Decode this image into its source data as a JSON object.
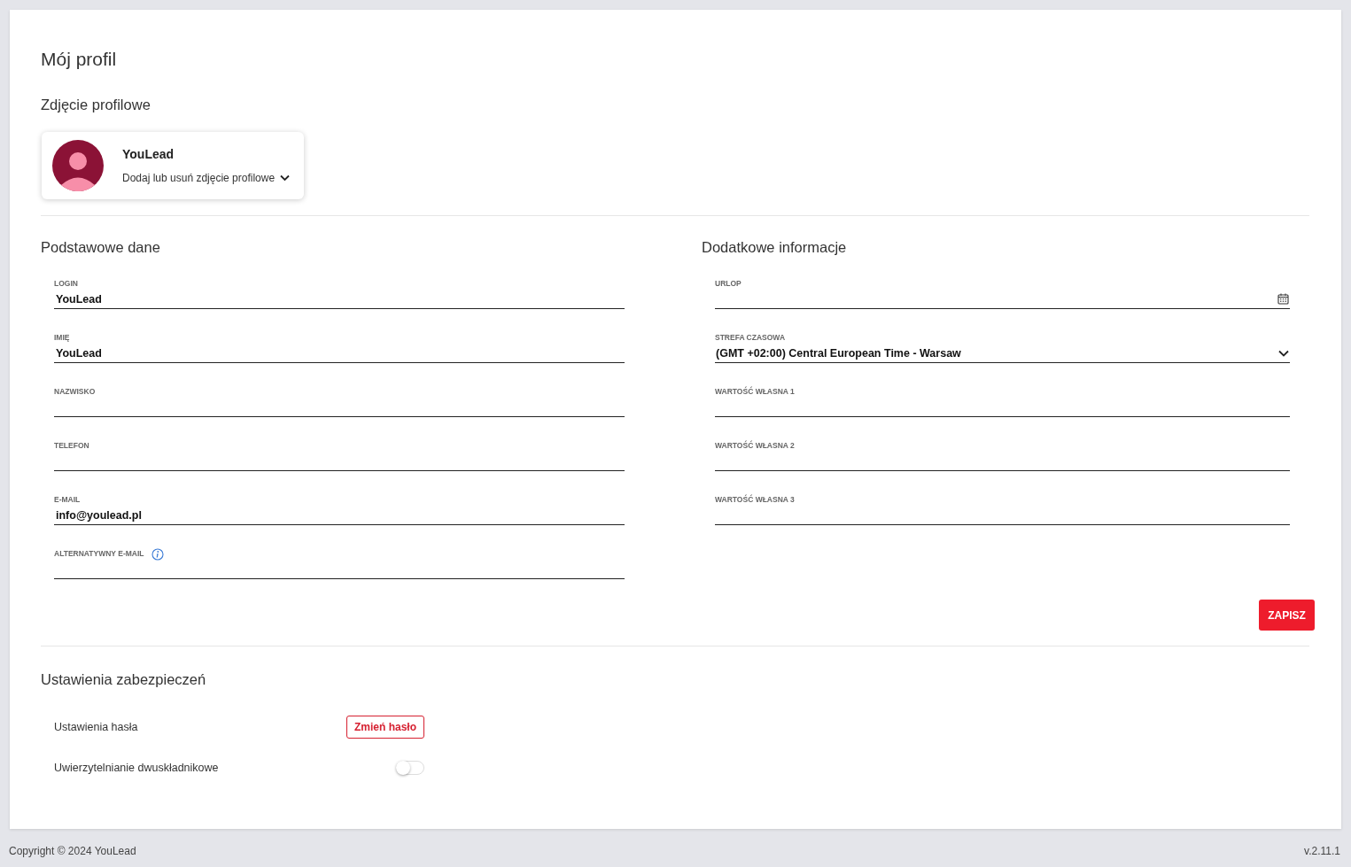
{
  "page_title": "Mój profil",
  "profile_photo": {
    "heading": "Zdjęcie profilowe",
    "name": "YouLead",
    "action": "Dodaj lub usuń zdjęcie profilowe"
  },
  "basic_data": {
    "heading": "Podstawowe dane",
    "fields": [
      {
        "kind": "text",
        "label": "LOGIN",
        "value": "YouLead"
      },
      {
        "kind": "text",
        "label": "IMIĘ",
        "value": "YouLead"
      },
      {
        "kind": "text",
        "label": "NAZWISKO"
      },
      {
        "kind": "text",
        "label": "TELEFON"
      },
      {
        "kind": "text",
        "label": "E-MAIL",
        "value": "info@youlead.pl"
      },
      {
        "kind": "info",
        "label": "ALTERNATYWNY E-MAIL"
      }
    ]
  },
  "additional_info": {
    "heading": "Dodatkowe informacje",
    "fields": [
      {
        "kind": "date",
        "label": "URLOP"
      },
      {
        "kind": "select",
        "label": "STREFA CZASOWA",
        "value": "(GMT +02:00) Central European Time - Warsaw"
      },
      {
        "kind": "text",
        "label": "WARTOŚĆ WŁASNA 1"
      },
      {
        "kind": "text",
        "label": "WARTOŚĆ WŁASNA 2"
      },
      {
        "kind": "text",
        "label": "WARTOŚĆ WŁASNA 3"
      }
    ]
  },
  "save_button": "ZAPISZ",
  "security": {
    "heading": "Ustawienia zabezpieczeń",
    "rows": [
      {
        "kind": "button",
        "label": "Ustawienia hasła",
        "button": "Zmień hasło"
      },
      {
        "kind": "toggle",
        "label": "Uwierzytelnianie dwuskładnikowe",
        "on": false
      }
    ]
  },
  "footer": {
    "copyright": "Copyright © 2024 YouLead",
    "version": "v.2.11.1"
  }
}
